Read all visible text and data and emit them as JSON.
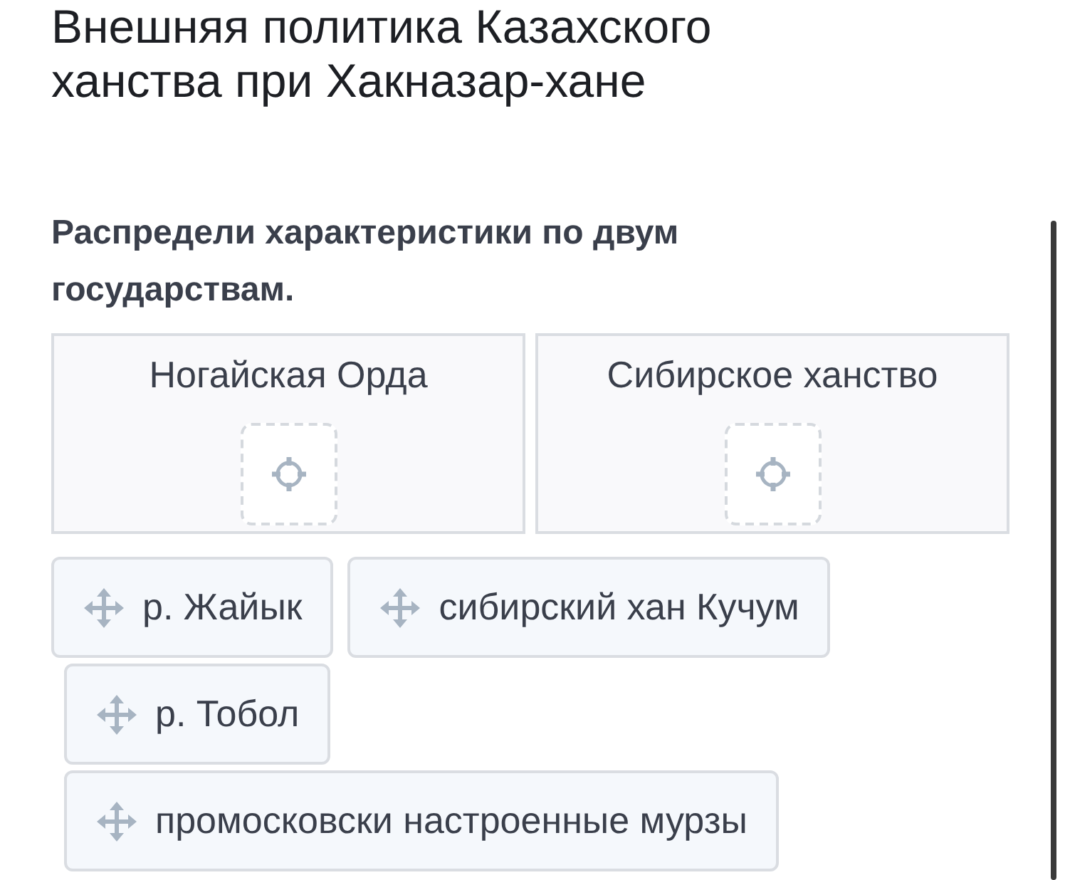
{
  "title": "Внешняя политика Казахского ханства при Хакназар-хане",
  "question": "Распредели характеристики по двум государствам.",
  "targets": [
    {
      "label": "Ногайская Орда"
    },
    {
      "label": "Сибирское ханство"
    }
  ],
  "items": [
    {
      "label": "р. Жайык"
    },
    {
      "label": "сибирский хан Кучум"
    },
    {
      "label": "р. Тобол"
    },
    {
      "label": "промосковски настроенные мурзы"
    }
  ]
}
